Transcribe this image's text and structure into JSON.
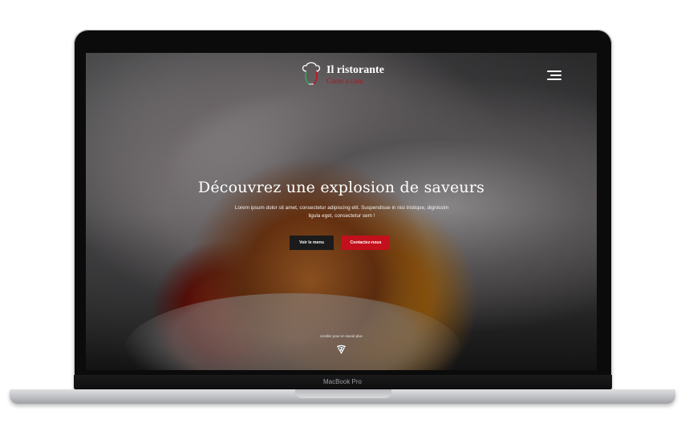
{
  "device": {
    "model_label": "MacBook Pro"
  },
  "header": {
    "brand": "Il ristorante",
    "tagline": "Come a casa",
    "menu_icon": "hamburger-menu-icon",
    "logo_icon": "chef-hat-icon"
  },
  "hero": {
    "title": "Découvrez une explosion de saveurs",
    "text": "Lorem ipsum dolor sit amet, consectetur adipiscing elit. Suspendisse in nisi tristique, dignissim ligula eget, consectetur sem !",
    "primary_button": "Voir le menu",
    "secondary_button": "Contactez-nous",
    "scroll_hint": "scroller pour en savoir plus",
    "scroll_icon": "pizza-slice-icon"
  },
  "colors": {
    "accent_red": "#c4101c",
    "dark_button": "#1b1b1c",
    "logo_green": "#3ca55c"
  }
}
